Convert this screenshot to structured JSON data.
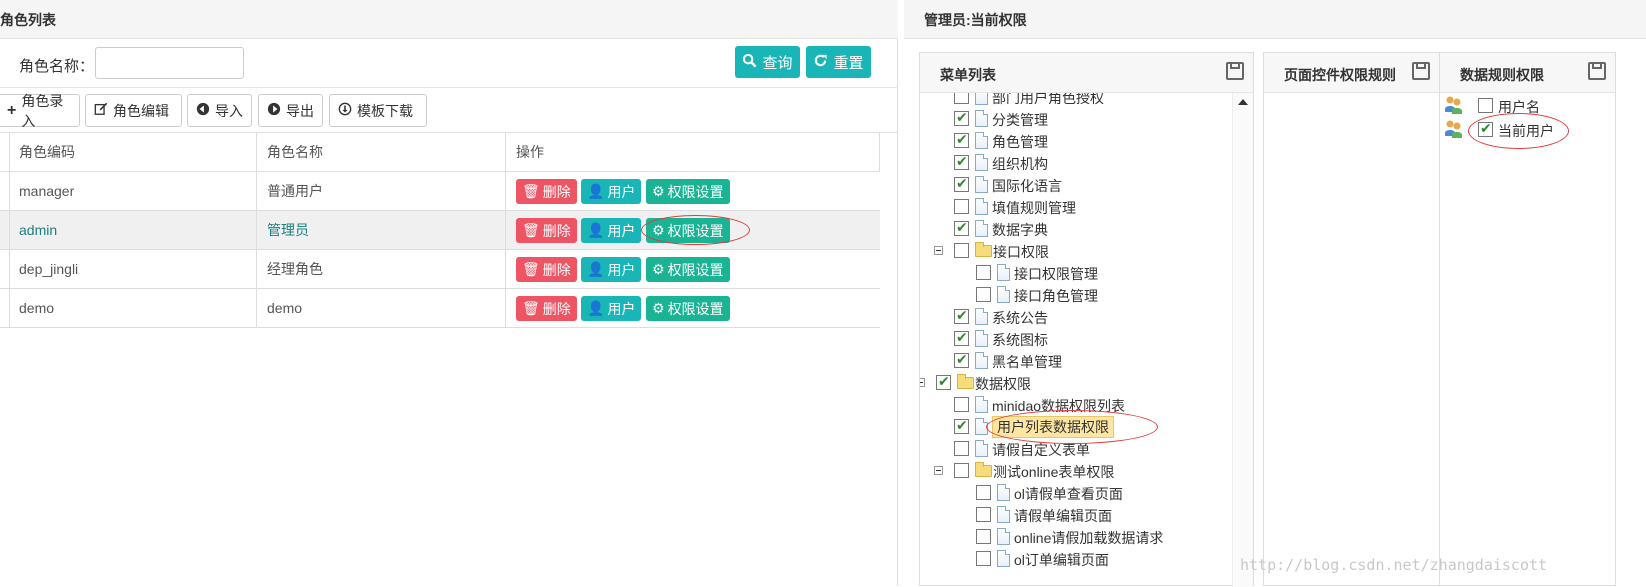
{
  "left": {
    "title": "角色列表",
    "search_label": "角色名称：",
    "search_value": "",
    "query_btn": "查询",
    "reset_btn": "重置",
    "toolbar": [
      "角色录入",
      "角色编辑",
      "导入",
      "导出",
      "模板下载"
    ],
    "columns": [
      "角色编码",
      "角色名称",
      "操作"
    ],
    "rows": [
      {
        "code": "manager",
        "name": "普通用户"
      },
      {
        "code": "admin",
        "name": "管理员"
      },
      {
        "code": "dep_jingli",
        "name": "经理角色"
      },
      {
        "code": "demo",
        "name": "demo"
      }
    ],
    "actions": {
      "delete": "删除",
      "user": "用户",
      "perm": "权限设置"
    }
  },
  "right": {
    "title": "管理员:当前权限",
    "menu_panel_title": "菜单列表",
    "page_panel_title": "页面控件权限规则",
    "data_panel_title": "数据规则权限",
    "tree": [
      {
        "label": "部门用户角色授权",
        "checked": false,
        "level": 2,
        "type": "doc"
      },
      {
        "label": "分类管理",
        "checked": true,
        "level": 2,
        "type": "doc"
      },
      {
        "label": "角色管理",
        "checked": true,
        "level": 2,
        "type": "doc"
      },
      {
        "label": "组织机构",
        "checked": true,
        "level": 2,
        "type": "doc"
      },
      {
        "label": "国际化语言",
        "checked": true,
        "level": 2,
        "type": "doc"
      },
      {
        "label": "填值规则管理",
        "checked": false,
        "level": 2,
        "type": "doc"
      },
      {
        "label": "数据字典",
        "checked": true,
        "level": 2,
        "type": "doc"
      },
      {
        "label": "接口权限",
        "checked": false,
        "level": 2,
        "type": "folder"
      },
      {
        "label": "接口权限管理",
        "checked": false,
        "level": 3,
        "type": "doc"
      },
      {
        "label": "接口角色管理",
        "checked": false,
        "level": 3,
        "type": "doc"
      },
      {
        "label": "系统公告",
        "checked": true,
        "level": 2,
        "type": "doc"
      },
      {
        "label": "系统图标",
        "checked": true,
        "level": 2,
        "type": "doc"
      },
      {
        "label": "黑名单管理",
        "checked": true,
        "level": 2,
        "type": "doc"
      },
      {
        "label": "数据权限",
        "checked": true,
        "level": 1,
        "type": "folder"
      },
      {
        "label": "minidao数据权限列表",
        "checked": false,
        "level": 2,
        "type": "doc"
      },
      {
        "label": "用户列表数据权限",
        "checked": true,
        "level": 2,
        "type": "doc",
        "selected": true
      },
      {
        "label": "请假自定义表单",
        "checked": false,
        "level": 2,
        "type": "doc"
      },
      {
        "label": "测试online表单权限",
        "checked": false,
        "level": 2,
        "type": "folder"
      },
      {
        "label": "ol请假单查看页面",
        "checked": false,
        "level": 3,
        "type": "doc"
      },
      {
        "label": "请假单编辑页面",
        "checked": false,
        "level": 3,
        "type": "doc"
      },
      {
        "label": "online请假加载数据请求",
        "checked": false,
        "level": 3,
        "type": "doc"
      },
      {
        "label": "ol订单编辑页面",
        "checked": false,
        "level": 3,
        "type": "doc"
      }
    ],
    "data_rules": [
      {
        "label": "用户名",
        "checked": false
      },
      {
        "label": "当前用户",
        "checked": true
      }
    ]
  },
  "watermark": "http://blog.csdn.net/zhangdaiscott"
}
